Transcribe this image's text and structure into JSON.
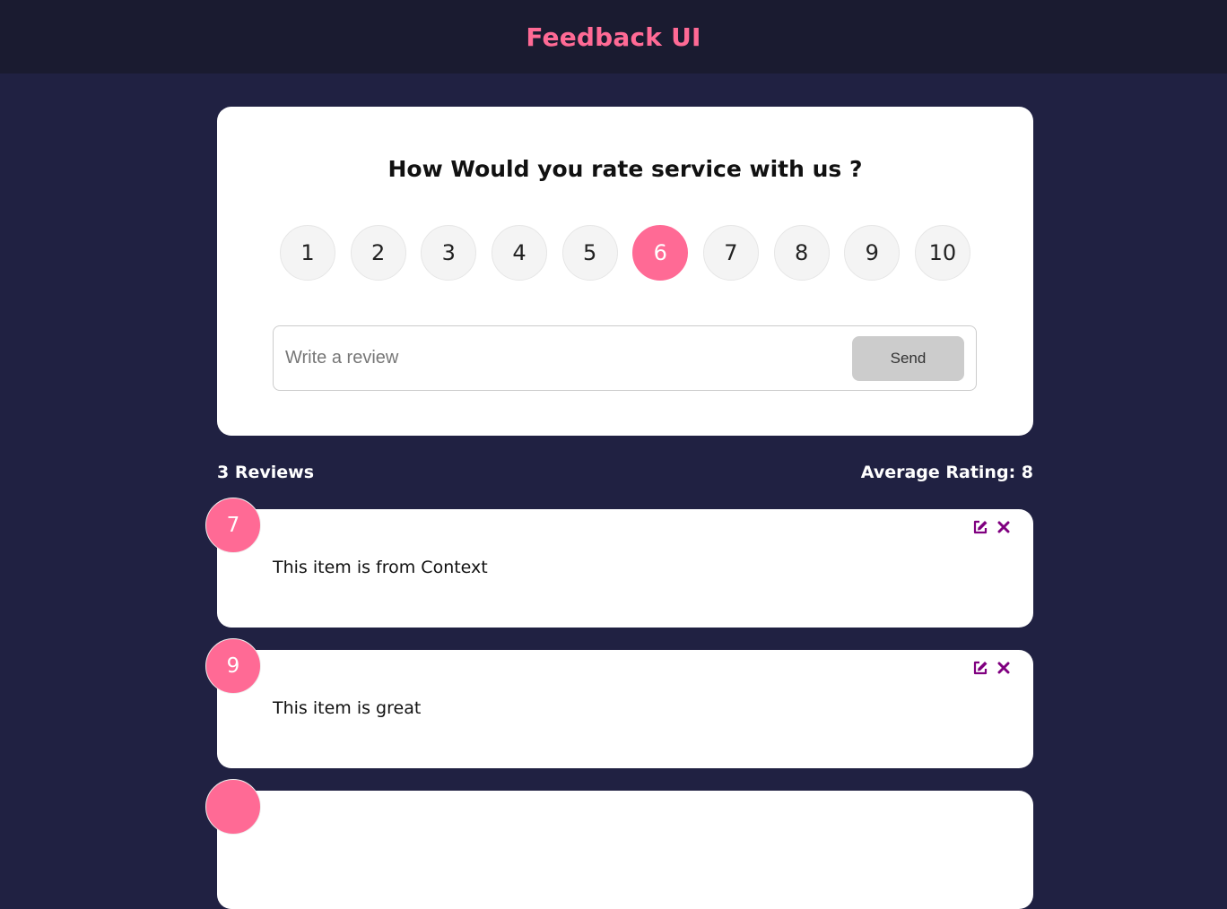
{
  "header": {
    "title": "Feedback UI"
  },
  "form": {
    "question": "How Would you rate service with us ?",
    "ratings": [
      "1",
      "2",
      "3",
      "4",
      "5",
      "6",
      "7",
      "8",
      "9",
      "10"
    ],
    "selected_rating": "6",
    "review_placeholder": "Write a review",
    "review_value": "",
    "send_label": "Send"
  },
  "stats": {
    "count_label": "3 Reviews",
    "average_label": "Average Rating: 8"
  },
  "reviews": [
    {
      "rating": "7",
      "text": "This item is from Context"
    },
    {
      "rating": "9",
      "text": "This item is great"
    },
    {
      "rating": "",
      "text": ""
    }
  ],
  "colors": {
    "accent": "#ff6a95",
    "background": "#202142",
    "header_bg": "#1a1b30",
    "icon": "#800080"
  },
  "icons": {
    "edit": "edit-icon",
    "delete": "close-icon"
  }
}
